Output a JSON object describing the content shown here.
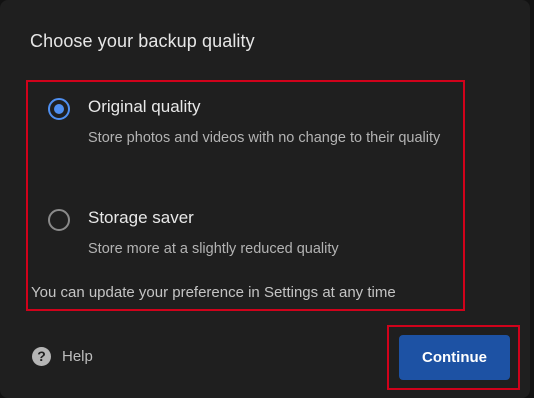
{
  "dialog": {
    "title": "Choose your backup quality",
    "options": [
      {
        "label": "Original quality",
        "description": "Store photos and videos with no change to their quality",
        "selected": true
      },
      {
        "label": "Storage saver",
        "description": "Store more at a slightly reduced quality",
        "selected": false
      }
    ],
    "note": "You can update your preference in Settings at any time",
    "help": {
      "icon": "help-circle-icon",
      "glyph": "?",
      "label": "Help"
    },
    "continue_label": "Continue"
  },
  "colors": {
    "background": "#1f1f1f",
    "accent": "#4f8ff0",
    "button": "#1d52a4",
    "highlight_border": "#d0021b"
  }
}
